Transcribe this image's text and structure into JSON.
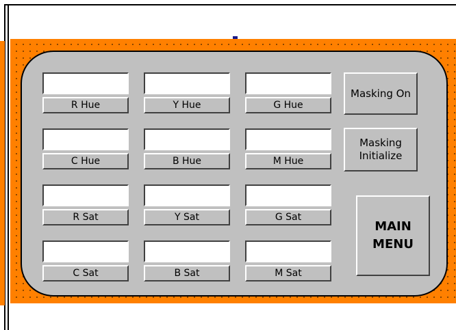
{
  "hue_sat_grid": [
    [
      "R Hue",
      "Y Hue",
      "G Hue"
    ],
    [
      "C Hue",
      "B Hue",
      "M Hue"
    ],
    [
      "R Sat",
      "Y Sat",
      "G Sat"
    ],
    [
      "C Sat",
      "B Sat",
      "M Sat"
    ]
  ],
  "side_buttons": {
    "masking_on": "Masking On",
    "masking_initialize": "Masking\nInitialize",
    "main_menu": "MAIN\nMENU"
  },
  "colors": {
    "background_band": "#ff8000",
    "panel": "#c0c0c0",
    "field": "#ffffff"
  }
}
